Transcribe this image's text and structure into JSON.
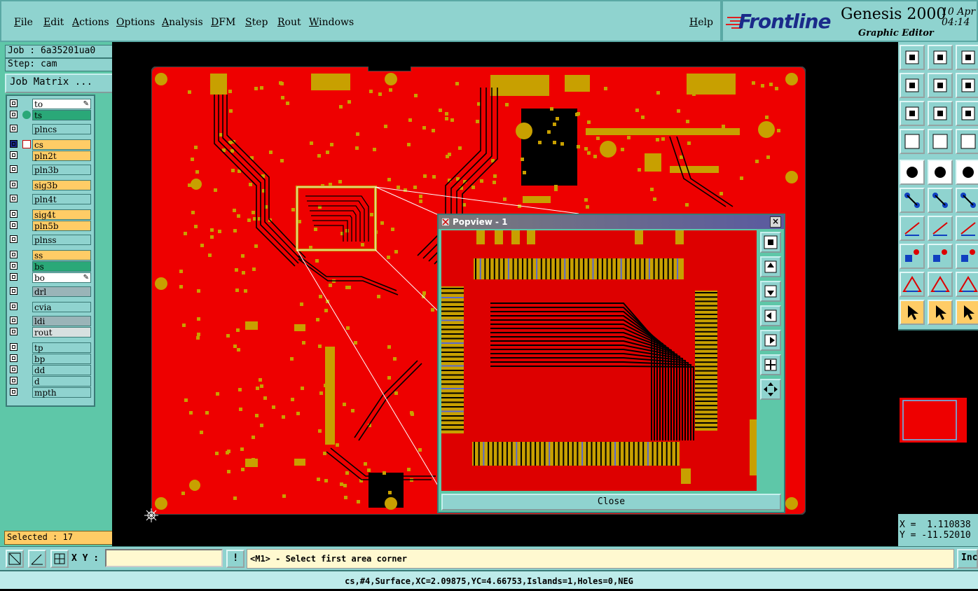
{
  "menu": {
    "items": [
      "File",
      "Edit",
      "Actions",
      "Options",
      "Analysis",
      "DFM",
      "Step",
      "Rout",
      "Windows"
    ],
    "help": "Help"
  },
  "brand": {
    "logo": "Frontline",
    "product": "Genesis 2000",
    "subtitle": "Graphic Editor",
    "date_line1": "10 Apr",
    "date_line2": "04:14"
  },
  "job": {
    "job_label": "Job : 6a35201ua0",
    "step_label": "Step: cam",
    "matrix_button": "Job Matrix ..."
  },
  "layers": [
    {
      "name": "to",
      "color": "#ffffff",
      "mark": "pen"
    },
    {
      "name": "ts",
      "color": "#2aa878",
      "mark": "dot"
    },
    {
      "name": "plncs",
      "color": "#8fd3cf",
      "mark": ""
    },
    {
      "name": "cs",
      "color": "#ffcc66",
      "mark": "edit",
      "active": true
    },
    {
      "name": "pln2t",
      "color": "#ffcc66",
      "mark": ""
    },
    {
      "name": "pln3b",
      "color": "#8fd3cf",
      "mark": ""
    },
    {
      "name": "sig3b",
      "color": "#ffcc66",
      "mark": ""
    },
    {
      "name": "pln4t",
      "color": "#8fd3cf",
      "mark": ""
    },
    {
      "name": "sig4t",
      "color": "#ffcc66",
      "mark": ""
    },
    {
      "name": "pln5b",
      "color": "#ffcc66",
      "mark": ""
    },
    {
      "name": "plnss",
      "color": "#8fd3cf",
      "mark": ""
    },
    {
      "name": "ss",
      "color": "#ffcc66",
      "mark": ""
    },
    {
      "name": "bs",
      "color": "#2aa878",
      "mark": ""
    },
    {
      "name": "bo",
      "color": "#ffffff",
      "mark": "pen"
    },
    {
      "name": "drl",
      "color": "#9ab4b8",
      "mark": ""
    },
    {
      "name": "cvia",
      "color": "#8fd3cf",
      "mark": ""
    },
    {
      "name": "ldi",
      "color": "#9ab4b8",
      "mark": ""
    },
    {
      "name": "rout",
      "color": "#d8e0e0",
      "mark": ""
    },
    {
      "name": "tp",
      "color": "#8fd3cf",
      "mark": ""
    },
    {
      "name": "bp",
      "color": "#8fd3cf",
      "mark": ""
    },
    {
      "name": "dd",
      "color": "#8fd3cf",
      "mark": ""
    },
    {
      "name": "d",
      "color": "#8fd3cf",
      "mark": ""
    },
    {
      "name": "mpth",
      "color": "#8fd3cf",
      "mark": ""
    }
  ],
  "selected": "Selected : 17",
  "popview": {
    "title": "Popview - 1",
    "close_label": "Close",
    "close_x": "×"
  },
  "coords": {
    "x": "X =  1.110838",
    "y": "Y = -11.52010"
  },
  "command": {
    "xy_label": "X Y :",
    "xy_value": "",
    "info_icon": "!",
    "prompt": "<M1> - Select first area corner",
    "inc_label": "Inc"
  },
  "status": "cs,#4,Surface,XC=2.09875,YC=4.66753,Islands=1,Holes=0,NEG",
  "colors": {
    "board": "#ee0000",
    "pad": "#c8a000",
    "trace": "#000000",
    "panel": "#8fd3cf",
    "panel_dark": "#5ec7a8",
    "highlight": "#ffcc66"
  }
}
